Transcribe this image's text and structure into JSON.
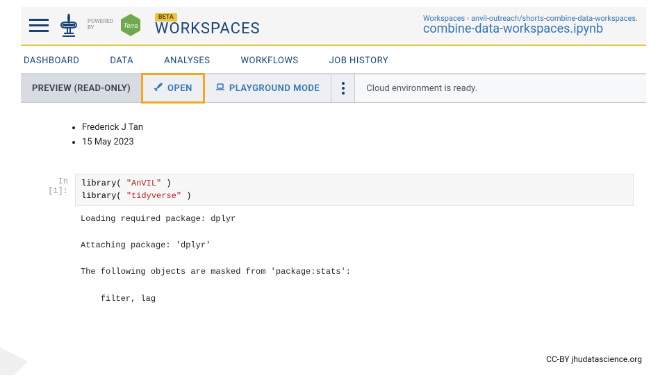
{
  "header": {
    "powered_by_line1": "POWERED",
    "powered_by_line2": "BY",
    "terra_label": "Terra",
    "beta_label": "BETA",
    "workspaces_title": "WORKSPACES",
    "breadcrumb_root": "Workspaces",
    "breadcrumb_path": "anvil-outreach/shorts-combine-data-workspaces",
    "notebook_title": "combine-data-workspaces.ipynb"
  },
  "tabs": {
    "dashboard": "DASHBOARD",
    "data": "DATA",
    "analyses": "ANALYSES",
    "workflows": "WORKFLOWS",
    "job_history": "JOB HISTORY"
  },
  "action_bar": {
    "preview": "PREVIEW (READ-ONLY)",
    "open": "OPEN",
    "playground": "PLAYGROUND MODE",
    "status": "Cloud environment is ready."
  },
  "notebook": {
    "author": "Frederick J Tan",
    "date": "15 May 2023",
    "prompt": "In [1]:",
    "code_pre1": "library( ",
    "code_str1": "\"AnVIL\"",
    "code_post1": " )",
    "code_pre2": "library( ",
    "code_str2": "\"tidyverse\"",
    "code_post2": " )",
    "output": "Loading required package: dplyr\n\nAttaching package: 'dplyr'\n\nThe following objects are masked from 'package:stats':\n\n    filter, lag"
  },
  "footer": {
    "attribution": "CC-BY  jhudatascience.org"
  }
}
